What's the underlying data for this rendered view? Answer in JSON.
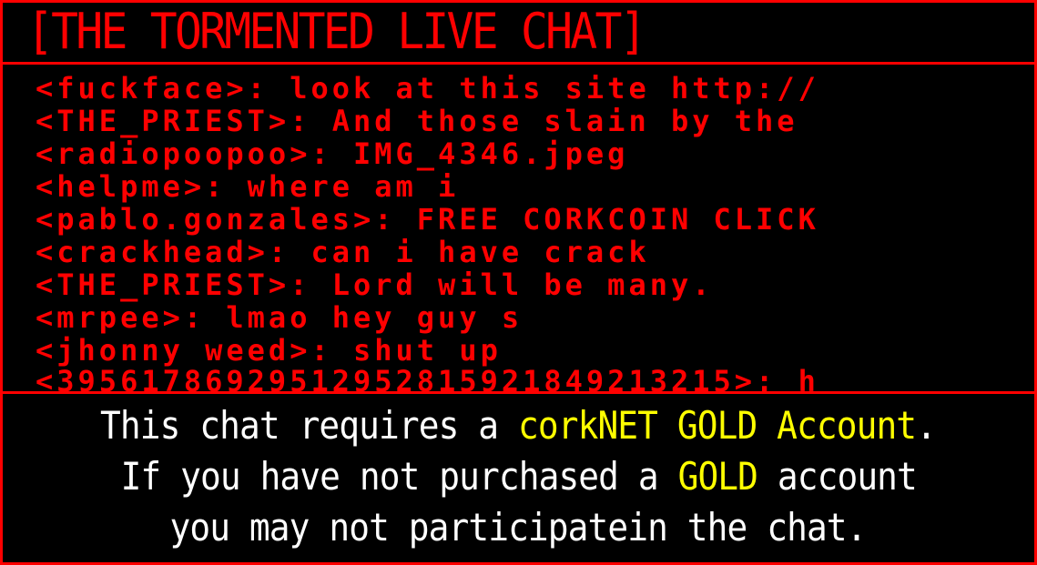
{
  "title": "[THE TORMENTED LIVE CHAT]",
  "colors": {
    "background": "#000000",
    "accent": "#ff0000",
    "gold": "#ffff00",
    "notice_text": "#ffffff"
  },
  "chat": {
    "messages": [
      {
        "user": "<fuckface>",
        "text": ": look at this site http://"
      },
      {
        "user": "<THE_PRIEST>",
        "text": ": And those slain by the"
      },
      {
        "user": "<radiopoopoo>",
        "text": ": IMG_4346.jpeg"
      },
      {
        "user": "<helpme>",
        "text": ": where am i"
      },
      {
        "user": "<pablo.gonzales>",
        "text": ": FREE CORKCOIN CLICK"
      },
      {
        "user": "<crackhead>",
        "text": ": can i have crack"
      },
      {
        "user": "<THE_PRIEST>",
        "text": ": Lord will be many."
      },
      {
        "user": "<mrpee>",
        "text": ": lmao hey guy s"
      },
      {
        "user": "<jhonny weed>",
        "text": ": shut up"
      },
      {
        "user": "<39561786929512952815921849213215>",
        "text": ": h"
      }
    ]
  },
  "notice": {
    "line1_pre": "This chat requires a ",
    "line1_gold": "corkNET GOLD Account",
    "line1_post": ".",
    "line2_pre": "If you have not purchased a ",
    "line2_gold": "GOLD",
    "line2_post": " account",
    "line3": "you may not participatein the chat."
  }
}
